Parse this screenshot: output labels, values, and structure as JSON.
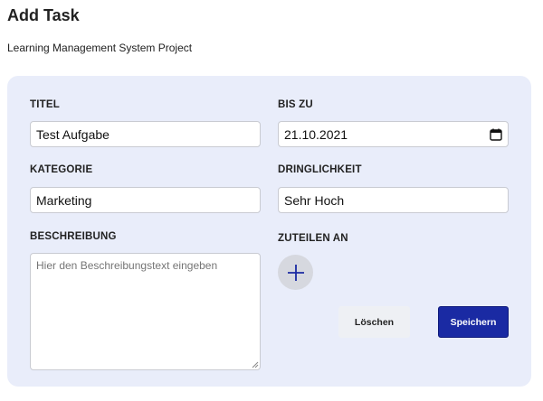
{
  "header": {
    "title": "Add Task",
    "project": "Learning Management System Project"
  },
  "form": {
    "title": {
      "label": "TITEL",
      "value": "Test Aufgabe"
    },
    "due_date": {
      "label": "BIS ZU",
      "value": "21.10.2021",
      "icon": "calendar-icon"
    },
    "category": {
      "label": "KATEGORIE",
      "value": "Marketing"
    },
    "priority": {
      "label": "DRINGLICHKEIT",
      "value": "Sehr Hoch"
    },
    "description": {
      "label": "BESCHREIBUNG",
      "placeholder": "Hier den Beschreibungstext eingeben"
    },
    "assign": {
      "label": "ZUTEILEN AN",
      "icon": "plus-icon"
    }
  },
  "actions": {
    "delete_label": "Löschen",
    "save_label": "Speichern"
  },
  "colors": {
    "card_background": "#e9edfa",
    "primary": "#1a2aa3",
    "plus_icon": "#1a2aa3"
  }
}
